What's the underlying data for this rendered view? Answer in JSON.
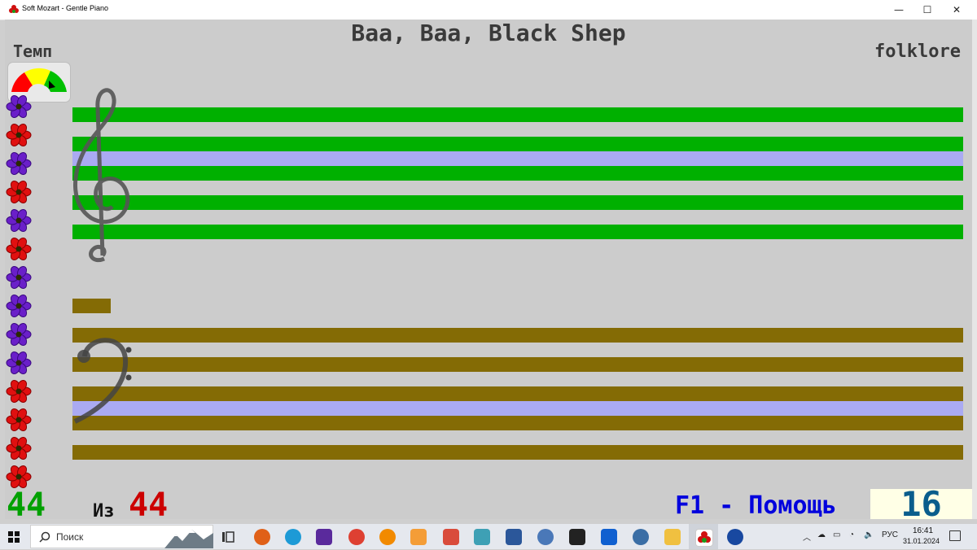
{
  "window": {
    "title": "Soft Mozart - Gentle Piano",
    "minimize_glyph": "—",
    "maximize_glyph": "☐",
    "close_glyph": "✕"
  },
  "song": {
    "title": "Baa, Baa, Black Shep",
    "composer": "folklore"
  },
  "tempo": {
    "label": "Темп",
    "colors": [
      "#ff0000",
      "#ffff00",
      "#00c000"
    ]
  },
  "staff": {
    "treble_color": "#00b000",
    "bass_color": "#846b05",
    "highlight_color": "#aaaaf2"
  },
  "sidebar": {
    "flowers": [
      "purple",
      "red",
      "purple",
      "red",
      "purple",
      "red",
      "purple",
      "purple",
      "purple",
      "purple",
      "red",
      "red",
      "red",
      "red"
    ]
  },
  "progress": {
    "current": "44",
    "of_label": "Из",
    "total": "44"
  },
  "help": {
    "label": "F1 - Помощь"
  },
  "score": {
    "value": "16"
  },
  "taskbar": {
    "search_placeholder": "Поиск",
    "language": "РУС",
    "time": "16:41",
    "date": "31.01.2024"
  }
}
